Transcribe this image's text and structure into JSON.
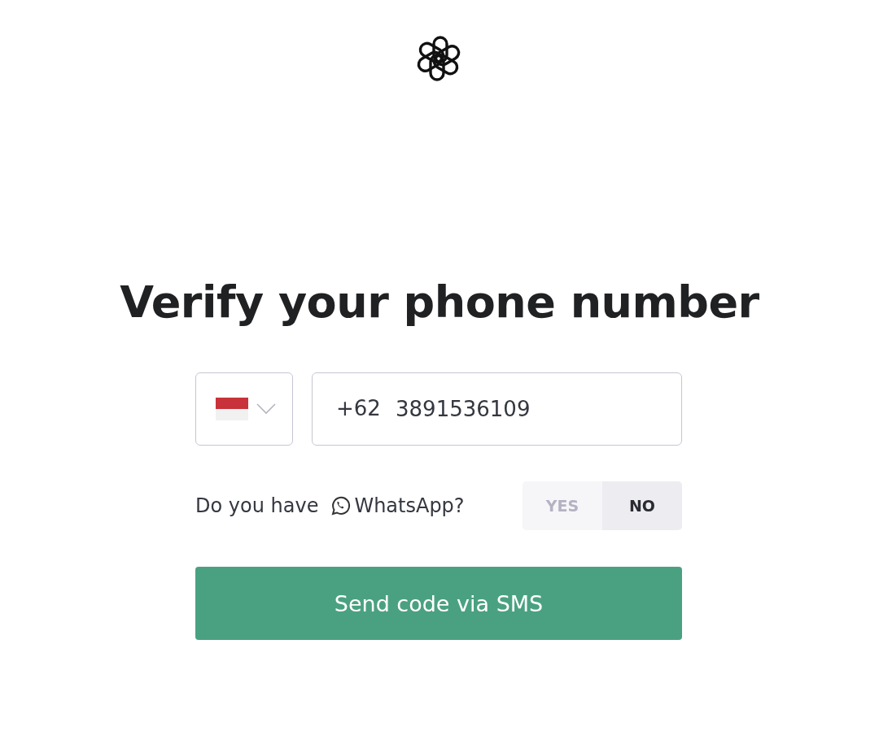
{
  "heading": "Verify your phone number",
  "phone": {
    "country_code": "+62",
    "value": "3891536109"
  },
  "whatsapp": {
    "question_before": "Do you have",
    "question_after": "WhatsApp?",
    "options": [
      {
        "label": "YES",
        "selected": false
      },
      {
        "label": "NO",
        "selected": true
      }
    ]
  },
  "submit_button": "Send code via SMS"
}
